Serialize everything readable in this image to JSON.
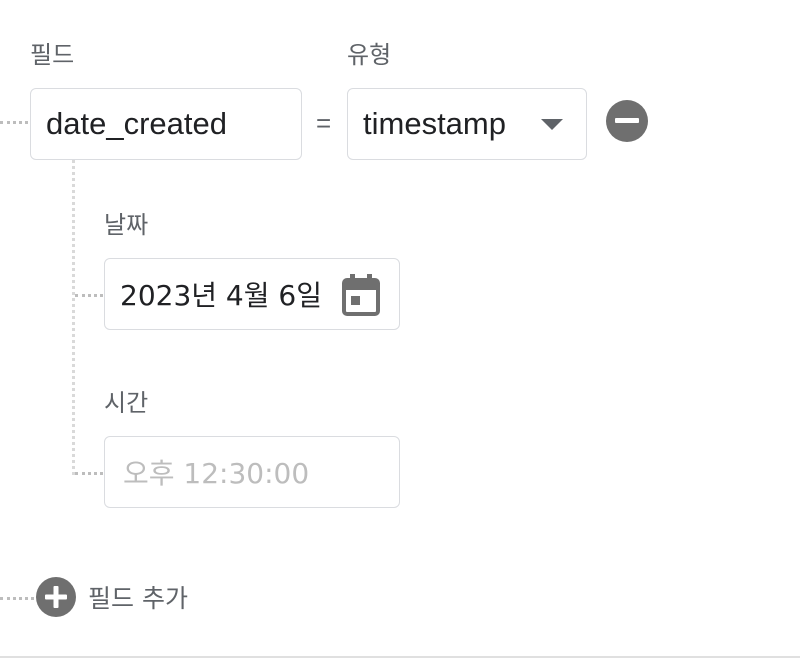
{
  "labels": {
    "field": "필드",
    "type": "유형",
    "date": "날짜",
    "time": "시간"
  },
  "field_row": {
    "field_value": "date_created",
    "operator": "=",
    "type_value": "timestamp"
  },
  "date_value": "2023년 4월 6일",
  "time_placeholder": "오후 12:30:00",
  "add_field_label": "필드 추가",
  "icons": {
    "remove": "remove-circle-icon",
    "calendar": "calendar-icon",
    "add": "add-circle-icon",
    "dropdown": "dropdown-arrow-icon"
  },
  "colors": {
    "label": "#5f6368",
    "border": "#dadce0",
    "icon": "#6f6f6f",
    "placeholder": "#bdbdbd"
  }
}
